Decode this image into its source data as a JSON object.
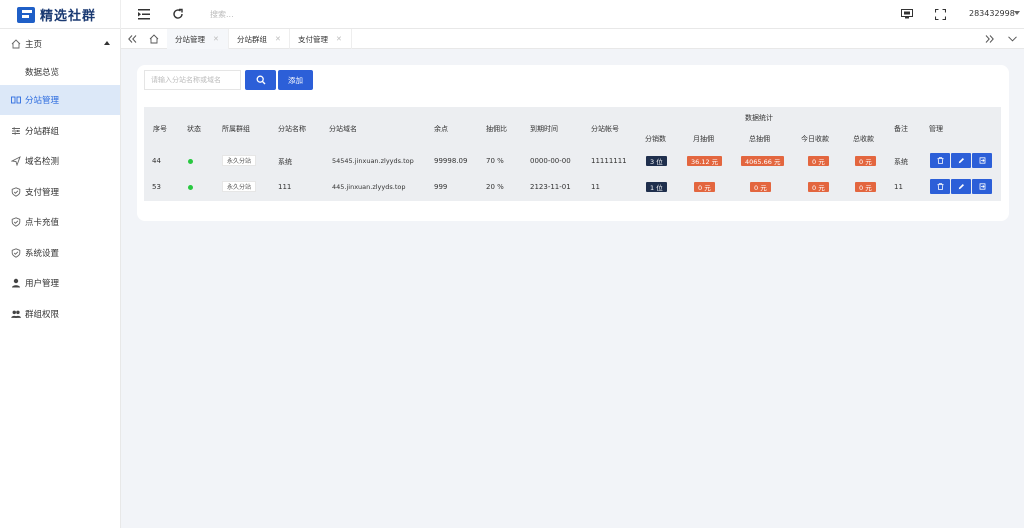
{
  "header": {
    "brand": "精选社群",
    "search_placeholder": "搜索...",
    "username": "283432998"
  },
  "sidebar": {
    "items": [
      {
        "label": "主页",
        "icon": "home-icon"
      },
      {
        "label": "数据总览",
        "icon": ""
      },
      {
        "label": "分站管理",
        "icon": "columns-icon"
      },
      {
        "label": "分站群组",
        "icon": "sliders-icon"
      },
      {
        "label": "域名检测",
        "icon": "send-icon"
      },
      {
        "label": "支付管理",
        "icon": "shield-check-icon"
      },
      {
        "label": "点卡充值",
        "icon": "shield-check-icon"
      },
      {
        "label": "系统设置",
        "icon": "shield-check-icon"
      },
      {
        "label": "用户管理",
        "icon": "user-icon"
      },
      {
        "label": "群组权限",
        "icon": "users-icon"
      }
    ]
  },
  "tabs": [
    {
      "label": "分站管理"
    },
    {
      "label": "分站群组"
    },
    {
      "label": "支付管理"
    }
  ],
  "toolbar": {
    "search_placeholder": "请输入分站名称或域名",
    "add_label": "添加"
  },
  "table": {
    "group_header": "数据统计",
    "headers": {
      "id": "序号",
      "status": "状态",
      "group": "所属群组",
      "name": "分站名称",
      "domain": "分站域名",
      "balance": "余点",
      "ratio": "抽佣比",
      "expire": "到期时间",
      "account": "分站帐号",
      "sub_count": "分销数",
      "month_comm": "月抽佣",
      "total_comm": "总抽佣",
      "today_income": "今日收款",
      "total_income": "总收款",
      "remark": "备注",
      "manage": "管理"
    },
    "rows": [
      {
        "id": "44",
        "group": "永久分站",
        "name": "系统",
        "domain": "54545.jinxuan.zlyyds.top",
        "balance": "99998.09",
        "ratio": "70 %",
        "expire": "0000-00-00",
        "account": "11111111",
        "sub_count": "3 位",
        "month_comm": "36.12 元",
        "total_comm": "4065.66 元",
        "today_income": "0 元",
        "total_income": "0 元",
        "remark": "系统"
      },
      {
        "id": "53",
        "group": "永久分站",
        "name": "111",
        "domain": "445.jinxuan.zlyyds.top",
        "balance": "999",
        "ratio": "20 %",
        "expire": "2123-11-01",
        "account": "11",
        "sub_count": "1 位",
        "month_comm": "0 元",
        "total_comm": "0 元",
        "today_income": "0 元",
        "total_income": "0 元",
        "remark": "11"
      }
    ]
  },
  "colors": {
    "primary": "#2c5fd8",
    "badge_red": "#e3663f",
    "badge_dark": "#1f2f4d",
    "status_green": "#28c840",
    "sidebar_active_bg": "#dce8f8"
  }
}
